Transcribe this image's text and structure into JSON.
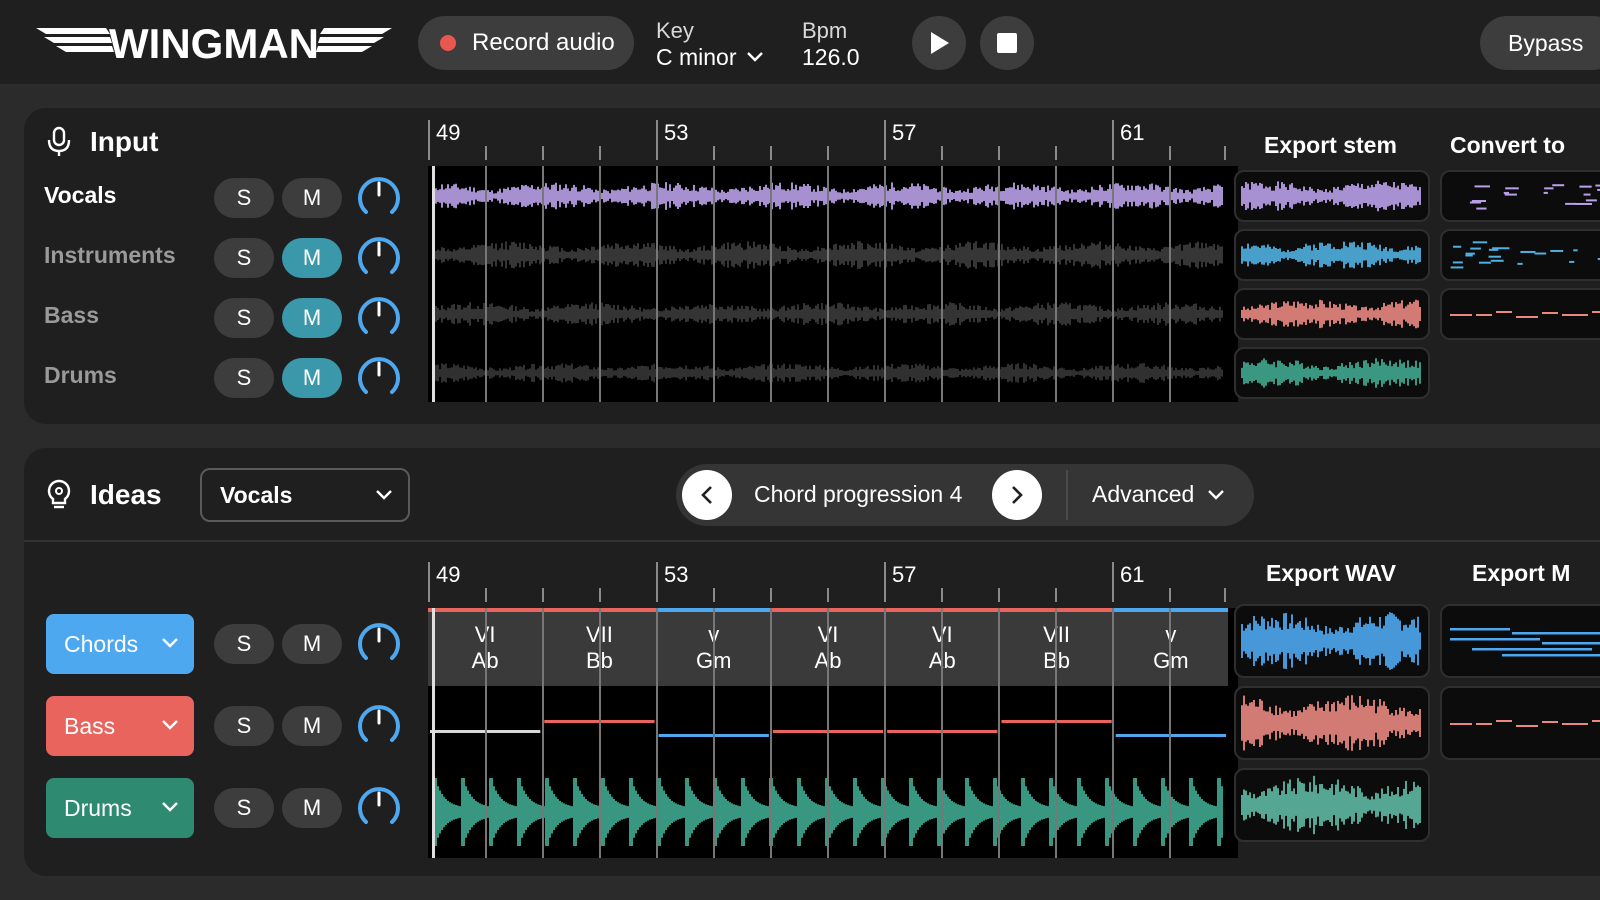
{
  "header": {
    "logo_text": "WINGMAN",
    "record_label": "Record audio",
    "key_label": "Key",
    "key_value": "C minor",
    "bpm_label": "Bpm",
    "bpm_value": "126.0",
    "bypass_label": "Bypass"
  },
  "input": {
    "title": "Input",
    "tracks": [
      {
        "name": "Vocals",
        "solo": "S",
        "mute": "M",
        "muted": false
      },
      {
        "name": "Instruments",
        "solo": "S",
        "mute": "M",
        "muted": true
      },
      {
        "name": "Bass",
        "solo": "S",
        "mute": "M",
        "muted": true
      },
      {
        "name": "Drums",
        "solo": "S",
        "mute": "M",
        "muted": true
      }
    ],
    "bar_numbers": [
      "49",
      "53",
      "57",
      "61"
    ],
    "export_stem_label": "Export stem",
    "convert_label": "Convert to"
  },
  "ideas": {
    "title": "Ideas",
    "source_select": "Vocals",
    "progression_label": "Chord progression 4",
    "advanced_label": "Advanced",
    "bar_numbers": [
      "49",
      "53",
      "57",
      "61"
    ],
    "export_wav_label": "Export WAV",
    "export_midi_label": "Export M",
    "tracks": [
      {
        "name": "Chords",
        "solo": "S",
        "mute": "M",
        "color": "#4ea8f0"
      },
      {
        "name": "Bass",
        "solo": "S",
        "mute": "M",
        "color": "#e8645c"
      },
      {
        "name": "Drums",
        "solo": "S",
        "mute": "M",
        "color": "#2f8a72"
      }
    ],
    "chords": [
      {
        "numeral": "VI",
        "name": "Ab",
        "accent": "#e8645c"
      },
      {
        "numeral": "VII",
        "name": "Bb",
        "accent": "#e8645c"
      },
      {
        "numeral": "v",
        "name": "Gm",
        "accent": "#4ea8f0"
      },
      {
        "numeral": "VI",
        "name": "Ab",
        "accent": "#e8645c"
      },
      {
        "numeral": "VI",
        "name": "Ab",
        "accent": "#e8645c"
      },
      {
        "numeral": "VII",
        "name": "Bb",
        "accent": "#e8645c"
      },
      {
        "numeral": "v",
        "name": "Gm",
        "accent": "#4ea8f0"
      }
    ]
  },
  "colors": {
    "vocals": "#b9a0e8",
    "instruments": "#3a3a3a",
    "stem_blue": "#4eb0e0",
    "stem_red": "#e88880",
    "stem_green": "#3fa890",
    "mute_active": "#3b98ab",
    "knob_blue": "#4ea8f0"
  }
}
